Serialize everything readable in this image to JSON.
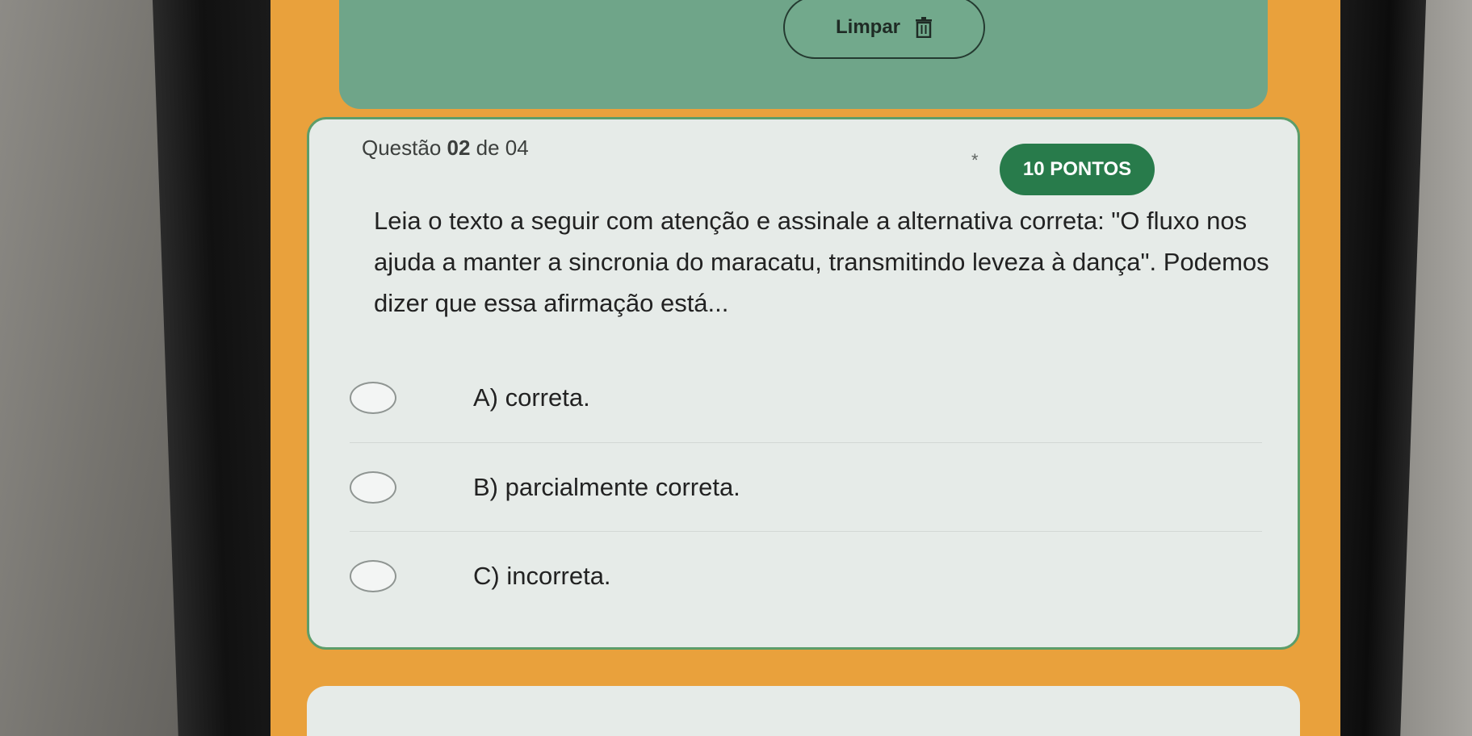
{
  "toolbar": {
    "clear_label": "Limpar",
    "clear_icon": "trash-icon"
  },
  "question": {
    "prefix": "Questão ",
    "number": "02",
    "suffix": " de 04",
    "required_mark": "*",
    "points": "10 PONTOS",
    "text": "Leia o texto a seguir com atenção e assinale a alternativa correta: \"O fluxo nos ajuda a manter a sincronia do maracatu, transmitindo leveza à dança\". Podemos dizer que essa afirmação está...",
    "options": [
      {
        "label": "A) correta."
      },
      {
        "label": "B) parcialmente correta."
      },
      {
        "label": "C) incorreta."
      }
    ]
  },
  "colors": {
    "page_background": "#e9a13c",
    "banner": "#6fa589",
    "card": "#e6ebe8",
    "card_border": "#5c9d6a",
    "badge": "#287b4b"
  }
}
